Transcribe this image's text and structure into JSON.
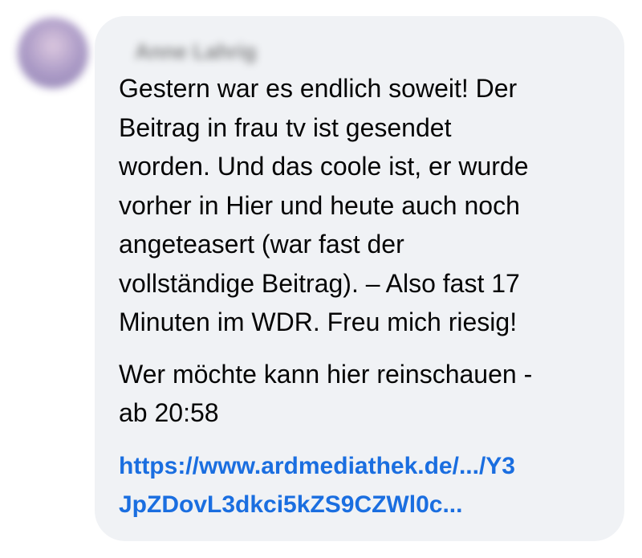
{
  "comment": {
    "author_name": "Anne Lahrig",
    "paragraph_1": "Gestern war es endlich soweit! Der\nBeitrag in frau tv ist gesendet\nworden. Und das coole ist, er wurde\nvorher in Hier und heute auch noch\nangeteasert (war fast der\nvollständige Beitrag). – Also fast 17\nMinuten im WDR. Freu mich riesig!",
    "paragraph_2": "Wer möchte kann hier reinschauen -\nab 20:58",
    "link_text": "https://www.ardmediathek.de/.../Y3\nJpZDovL3dkci5kZS9CZWl0c...",
    "bubble_color": "#f0f2f5",
    "link_color": "#1a6ee0"
  }
}
